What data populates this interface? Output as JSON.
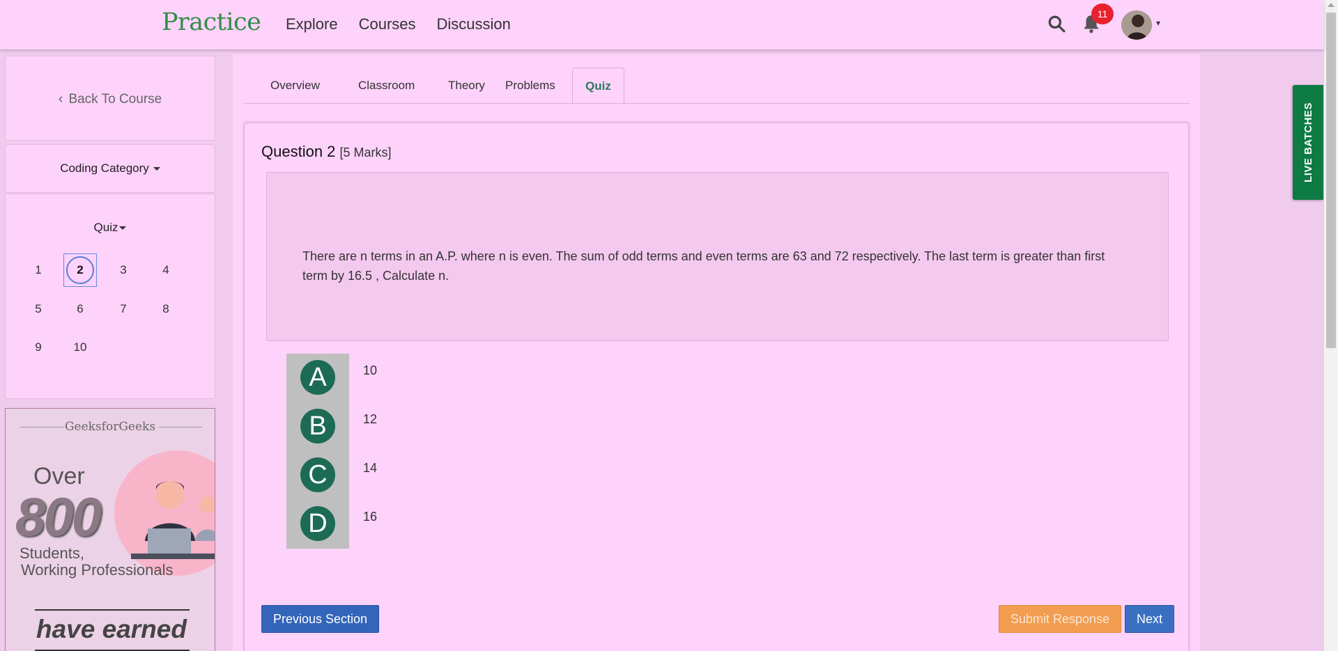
{
  "header": {
    "logo": "Practice",
    "nav": [
      "Explore",
      "Courses",
      "Discussion"
    ],
    "notification_count": "11"
  },
  "sidebar": {
    "back_label": "Back To Course",
    "category_label": "Coding Category",
    "quiz_label": "Quiz",
    "questions": [
      "1",
      "2",
      "3",
      "4",
      "5",
      "6",
      "7",
      "8",
      "9",
      "10"
    ],
    "current_question": "2"
  },
  "promo": {
    "brand": "GeeksforGeeks",
    "over": "Over",
    "number": "800",
    "students_line1": "Students,",
    "students_line2": "Working Professionals",
    "earned": "have earned"
  },
  "tabs": [
    "Overview",
    "Classroom",
    "Theory",
    "Problems",
    "Quiz"
  ],
  "active_tab": "Quiz",
  "question": {
    "title": "Question 2",
    "marks": "[5 Marks]",
    "text": "There are n terms in an A.P. where n is even. The sum of odd terms and even terms are 63 and 72 respectively. The last term is greater than first term by 16.5 , Calculate n.",
    "options": [
      {
        "letter": "A",
        "value": "10"
      },
      {
        "letter": "B",
        "value": "12"
      },
      {
        "letter": "C",
        "value": "14"
      },
      {
        "letter": "D",
        "value": "16"
      }
    ]
  },
  "buttons": {
    "previous": "Previous Section",
    "submit": "Submit Response",
    "next": "Next"
  },
  "live_batches": "LIVE  BATCHES",
  "colors": {
    "background": "#fdd2fb",
    "brand_green": "#2f8d46",
    "option_green": "#1d6b55",
    "primary_blue": "#3365ba",
    "submit_orange": "#f29d4f",
    "badge_red": "#e8202f"
  }
}
